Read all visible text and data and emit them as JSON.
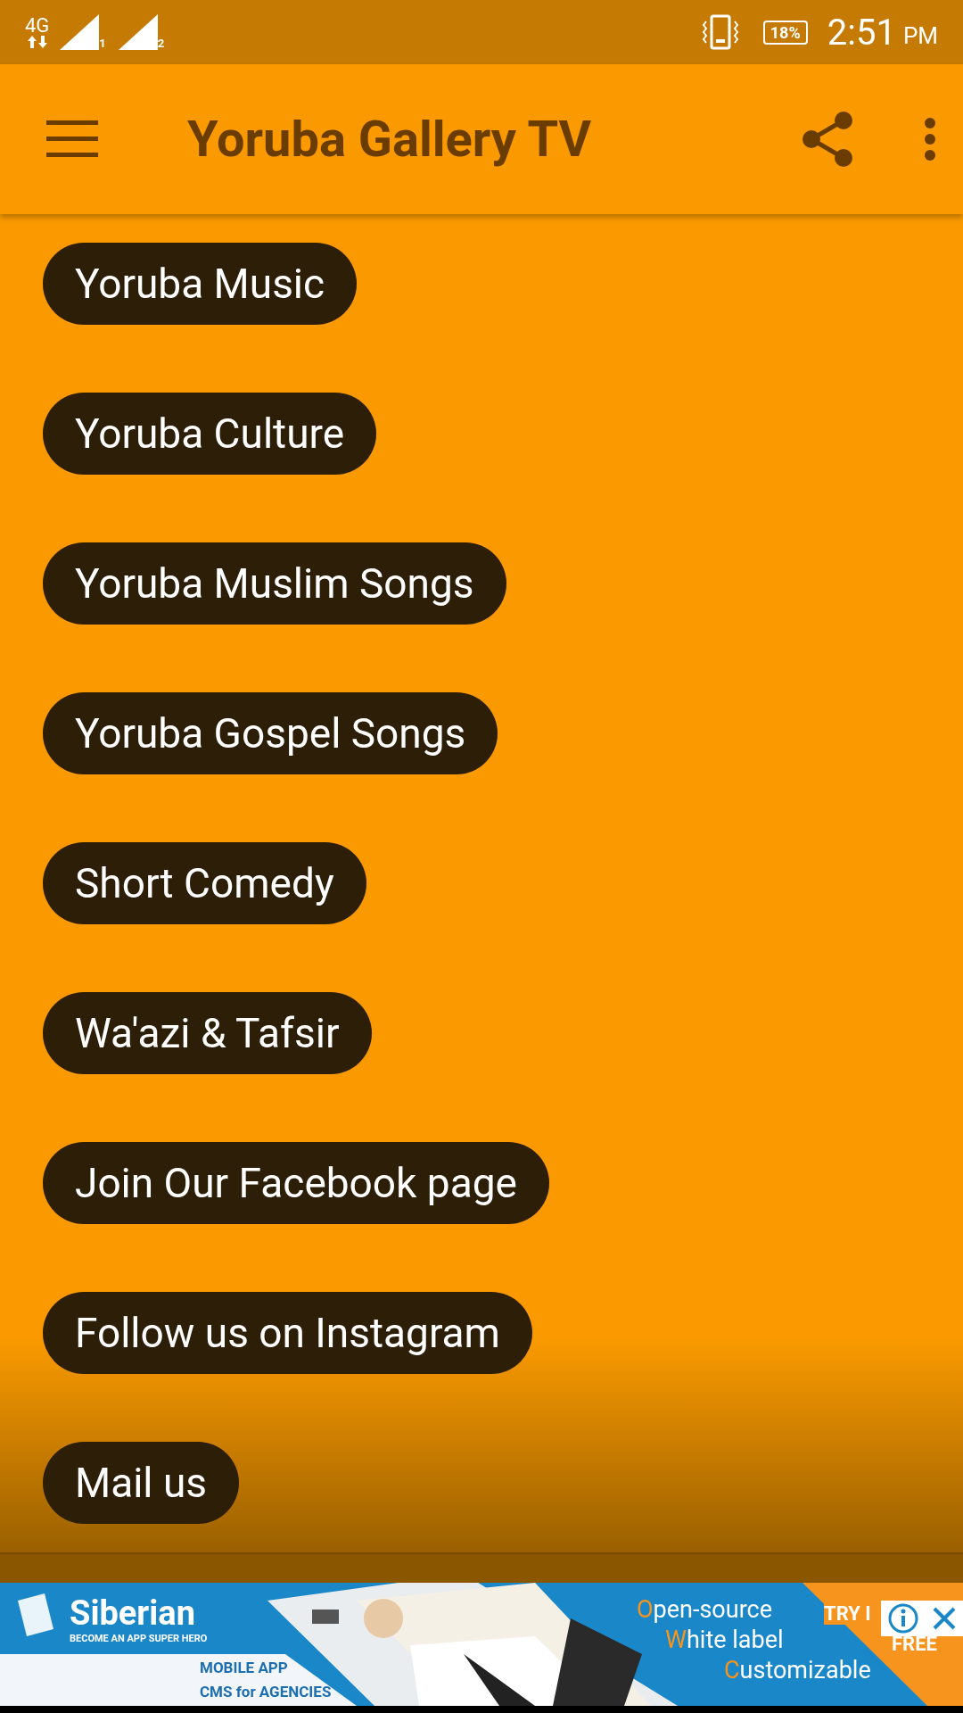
{
  "status_bar": {
    "network": "4G",
    "sim_labels": [
      "1",
      "2"
    ],
    "battery": "18%",
    "time": "2:51",
    "ampm": "PM"
  },
  "app_bar": {
    "title": "Yoruba Gallery TV"
  },
  "menu_buttons": [
    {
      "label": "Yoruba Music"
    },
    {
      "label": "Yoruba Culture"
    },
    {
      "label": "Yoruba Muslim Songs"
    },
    {
      "label": "Yoruba Gospel Songs"
    },
    {
      "label": "Short Comedy"
    },
    {
      "label": "Wa'azi & Tafsir"
    },
    {
      "label": "Join Our Facebook page"
    },
    {
      "label": "Follow us on Instagram"
    },
    {
      "label": "Mail us"
    }
  ],
  "ad_banner": {
    "brand": "Siberian",
    "tagline": "BECOME AN APP SUPER HERO",
    "line_1": "MOBILE APP",
    "line_2": "CMS for AGENCIES",
    "features": [
      "Open-source",
      "White label",
      "Customizable"
    ],
    "cta_1": "TRY I",
    "cta_2": "FREE"
  }
}
